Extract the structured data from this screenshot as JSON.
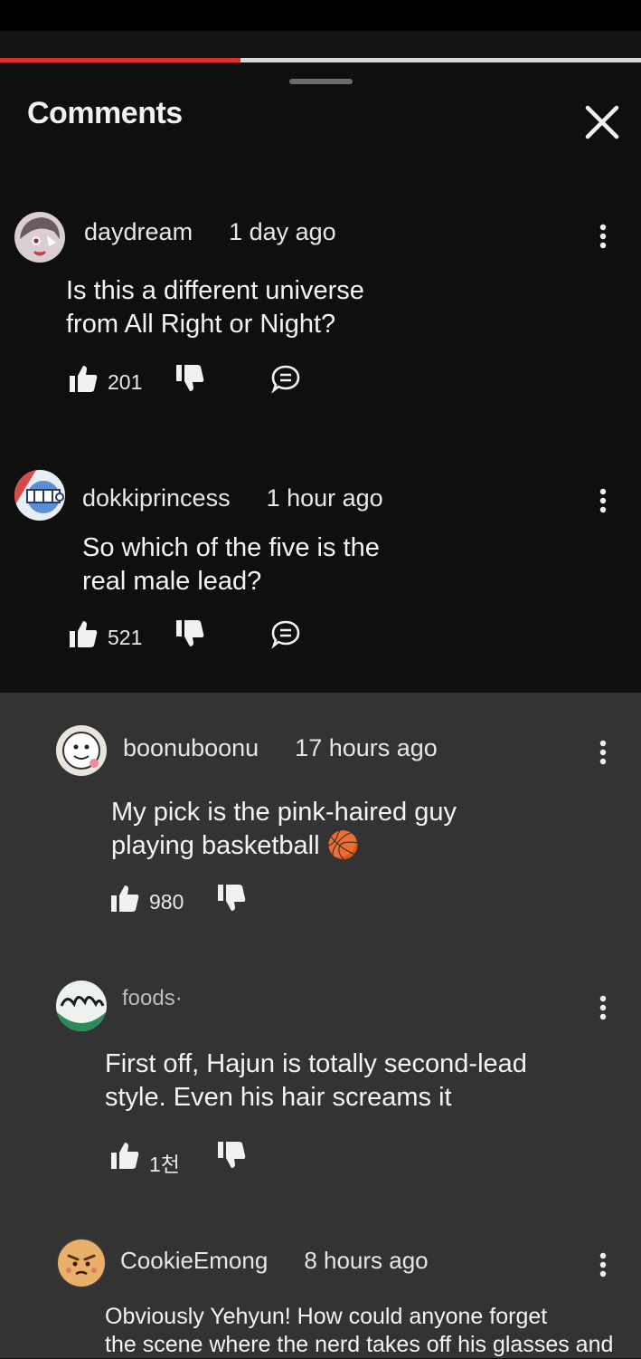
{
  "video": {
    "progress": 0.375
  },
  "sheet": {
    "title": "Comments"
  },
  "comments": [
    {
      "author": "daydream",
      "time": "1 day ago",
      "line1": "Is this a different universe",
      "line2": "from All Right or Night?",
      "likes": "201"
    },
    {
      "author": "dokkiprincess",
      "time": "1 hour ago",
      "line1": "So which of the five is the",
      "line2": "real male lead?",
      "likes": "521"
    }
  ],
  "replies": [
    {
      "author": "boonuboonu",
      "time": "17 hours ago",
      "line1": "My pick is the pink-haired guy",
      "line2": "playing basketball 🏀",
      "likes": "980"
    },
    {
      "author": "foods·",
      "time": "",
      "line1": "First off, Hajun is totally second-lead",
      "line2": "style. Even his hair screams it",
      "likes": "1천"
    },
    {
      "author": "CookieEmong",
      "time": "8 hours ago",
      "line1": "Obviously Yehyun! How could anyone forget",
      "line2": "the scene where the nerd takes off his glasses and"
    }
  ],
  "colors": {
    "accent_red": "#e0302b",
    "sheet_bg": "#0f0f0f",
    "reply_bg": "#333333"
  }
}
